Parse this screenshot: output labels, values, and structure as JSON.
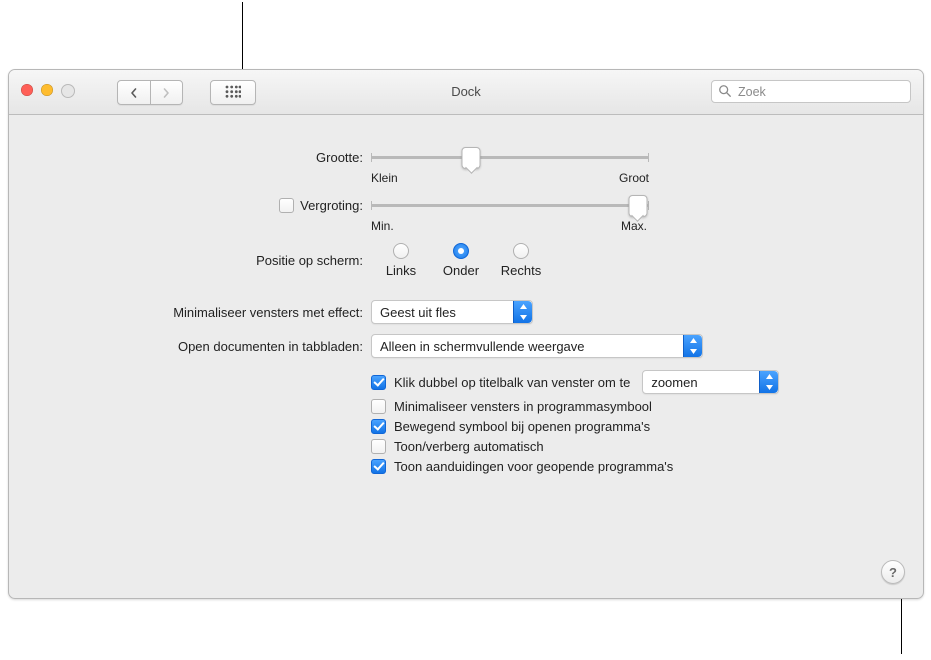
{
  "window": {
    "title": "Dock"
  },
  "search": {
    "placeholder": "Zoek",
    "value": ""
  },
  "size": {
    "label": "Grootte:",
    "min_label": "Klein",
    "max_label": "Groot",
    "value_pct": 36
  },
  "magnification": {
    "checkbox_checked": false,
    "label": "Vergroting:",
    "min_label": "Min.",
    "max_label": "Max.",
    "value_pct": 96
  },
  "position": {
    "label": "Positie op scherm:",
    "options": [
      "Links",
      "Onder",
      "Rechts"
    ],
    "selected_index": 1
  },
  "minimize_effect": {
    "label": "Minimaliseer vensters met effect:",
    "value": "Geest uit fles"
  },
  "open_docs": {
    "label": "Open documenten in tabbladen:",
    "value": "Alleen in schermvullende weergave"
  },
  "checkboxes": {
    "double_click": {
      "checked": true,
      "label": "Klik dubbel op titelbalk van venster om te",
      "action_value": "zoomen"
    },
    "minimize_into": {
      "checked": false,
      "label": "Minimaliseer vensters in programmasymbool"
    },
    "animate_open": {
      "checked": true,
      "label": "Bewegend symbool bij openen programma's"
    },
    "autohide": {
      "checked": false,
      "label": "Toon/verberg automatisch"
    },
    "indicators": {
      "checked": true,
      "label": "Toon aanduidingen voor geopende programma's"
    }
  },
  "help_button": "?"
}
